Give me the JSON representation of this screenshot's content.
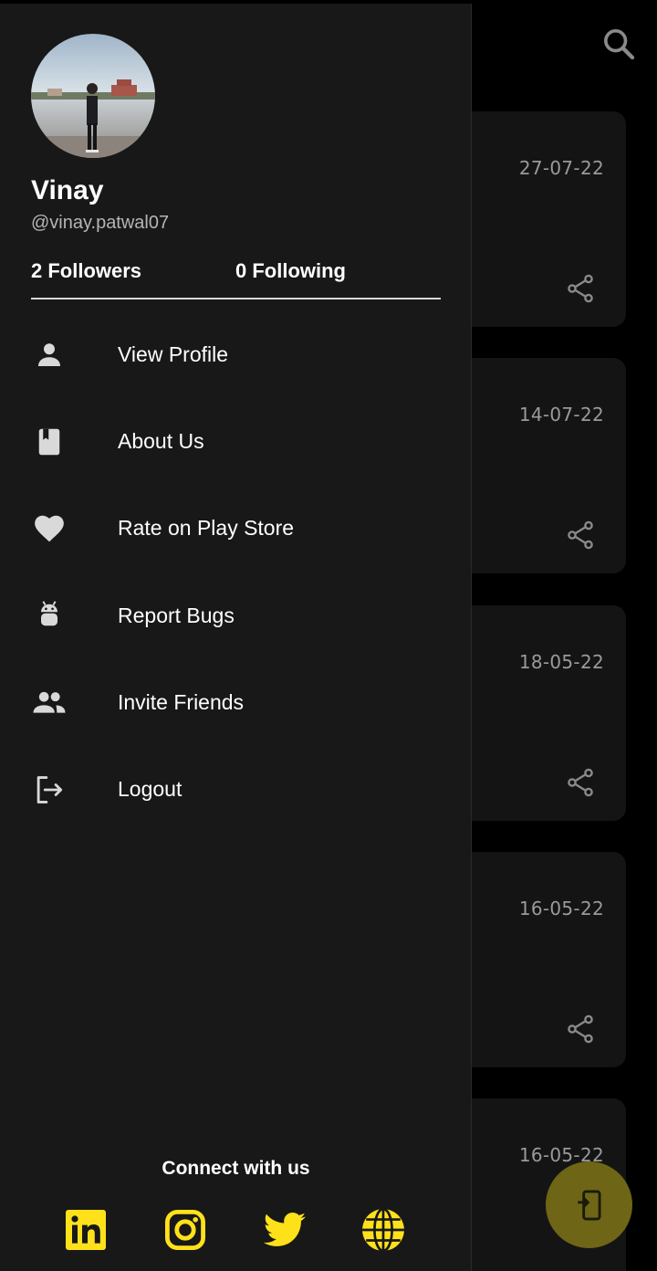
{
  "background": {
    "cards": [
      {
        "date": "27-07-22"
      },
      {
        "date": "14-07-22"
      },
      {
        "date": "18-05-22"
      },
      {
        "date": "16-05-22"
      },
      {
        "date": "16-05-22"
      }
    ],
    "search_icon": "search-icon",
    "share_icon": "share-icon",
    "fab_icon": "phone-add-icon"
  },
  "drawer": {
    "profile": {
      "name": "Vinay",
      "handle": "@vinay.patwal07",
      "followers": "2 Followers",
      "following": "0 Following"
    },
    "menu": [
      {
        "label": "View Profile",
        "icon": "person-icon"
      },
      {
        "label": "About Us",
        "icon": "book-icon"
      },
      {
        "label": "Rate on Play Store",
        "icon": "heart-icon"
      },
      {
        "label": "Report Bugs",
        "icon": "android-icon"
      },
      {
        "label": "Invite Friends",
        "icon": "people-icon"
      },
      {
        "label": "Logout",
        "icon": "logout-icon"
      }
    ],
    "connect": {
      "title": "Connect with us",
      "links": [
        "linkedin-icon",
        "instagram-icon",
        "twitter-icon",
        "website-globe-icon"
      ]
    }
  },
  "colors": {
    "drawer_bg": "#181818",
    "accent_yellow": "#ffe11a",
    "card_bg": "#141414",
    "fab": "#6e6516"
  }
}
